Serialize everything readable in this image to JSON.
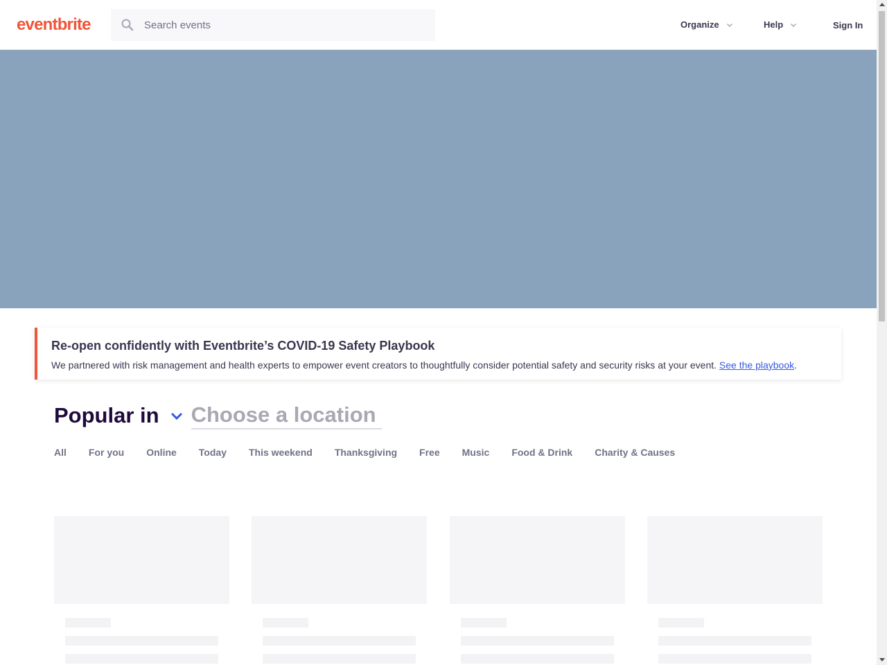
{
  "header": {
    "logo_text": "eventbrite",
    "search_placeholder": "Search events",
    "nav": {
      "organize": "Organize",
      "help": "Help",
      "sign_in": "Sign In"
    }
  },
  "banner": {
    "title": "Re-open confidently with Eventbrite’s COVID-19 Safety Playbook",
    "text": "We partnered with risk management and health experts to empower event creators to thoughtfully consider potential safety and security risks at your event. ",
    "link_text": "See the playbook",
    "suffix": "."
  },
  "popular": {
    "label": "Popular in",
    "location_placeholder": "Choose a location"
  },
  "tabs": [
    "All",
    "For you",
    "Online",
    "Today",
    "This weekend",
    "Thanksgiving",
    "Free",
    "Music",
    "Food & Drink",
    "Charity & Causes"
  ],
  "colors": {
    "brand": "#f05537",
    "hero": "#8aa3bc",
    "link": "#3659e3",
    "chevron": "#3659e3"
  }
}
